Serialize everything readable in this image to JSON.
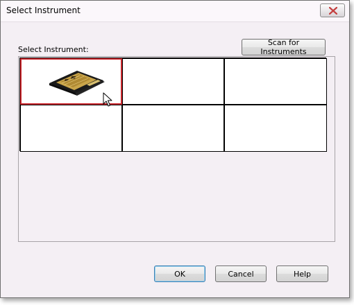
{
  "window": {
    "title": "Select Instrument"
  },
  "main": {
    "section_label": "Select Instrument:",
    "scan_button_label": "Scan for Instruments"
  },
  "instrument_grid": {
    "rows": 2,
    "columns": 3,
    "selected_index": 0,
    "cells": [
      {
        "icon": "instrument-device-icon",
        "selected": true
      },
      {
        "icon": "",
        "selected": false
      },
      {
        "icon": "",
        "selected": false
      },
      {
        "icon": "",
        "selected": false
      },
      {
        "icon": "",
        "selected": false
      },
      {
        "icon": "",
        "selected": false
      }
    ]
  },
  "footer": {
    "ok_label": "OK",
    "cancel_label": "Cancel",
    "help_label": "Help"
  },
  "colors": {
    "dialog_background": "#f4eff4",
    "selection_border": "#c8272d",
    "close_icon": "#c44040"
  }
}
